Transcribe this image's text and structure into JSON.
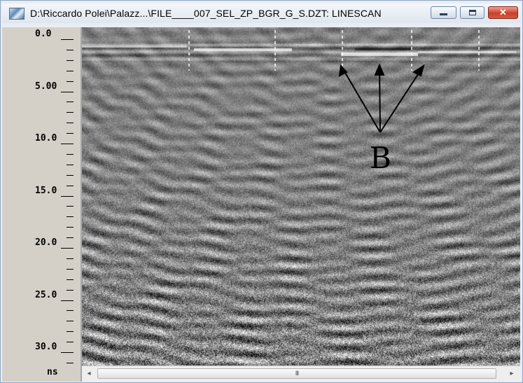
{
  "window": {
    "title": "D:\\Riccardo Polei\\Palazz...\\FILE____007_SEL_ZP_BGR_G_S.DZT:  LINESCAN",
    "app_icon": "grid-image-icon",
    "controls": {
      "minimize": "minimize-icon",
      "maximize": "maximize-icon",
      "close": "close-icon",
      "close_glyph": "✕"
    }
  },
  "depth_axis": {
    "unit": "ns",
    "labels": [
      "0.0",
      "5.00",
      "10.0",
      "15.0",
      "20.0",
      "25.0",
      "30.0"
    ]
  },
  "scan": {
    "annotation_label": "B",
    "arrow_color": "#000000"
  },
  "scrollbar": {
    "left_arrow": "◂",
    "right_arrow": "▸",
    "grip": "III"
  },
  "colors": {
    "ruler_bg": "#d4d0c8",
    "close_button": "#c8412a"
  }
}
